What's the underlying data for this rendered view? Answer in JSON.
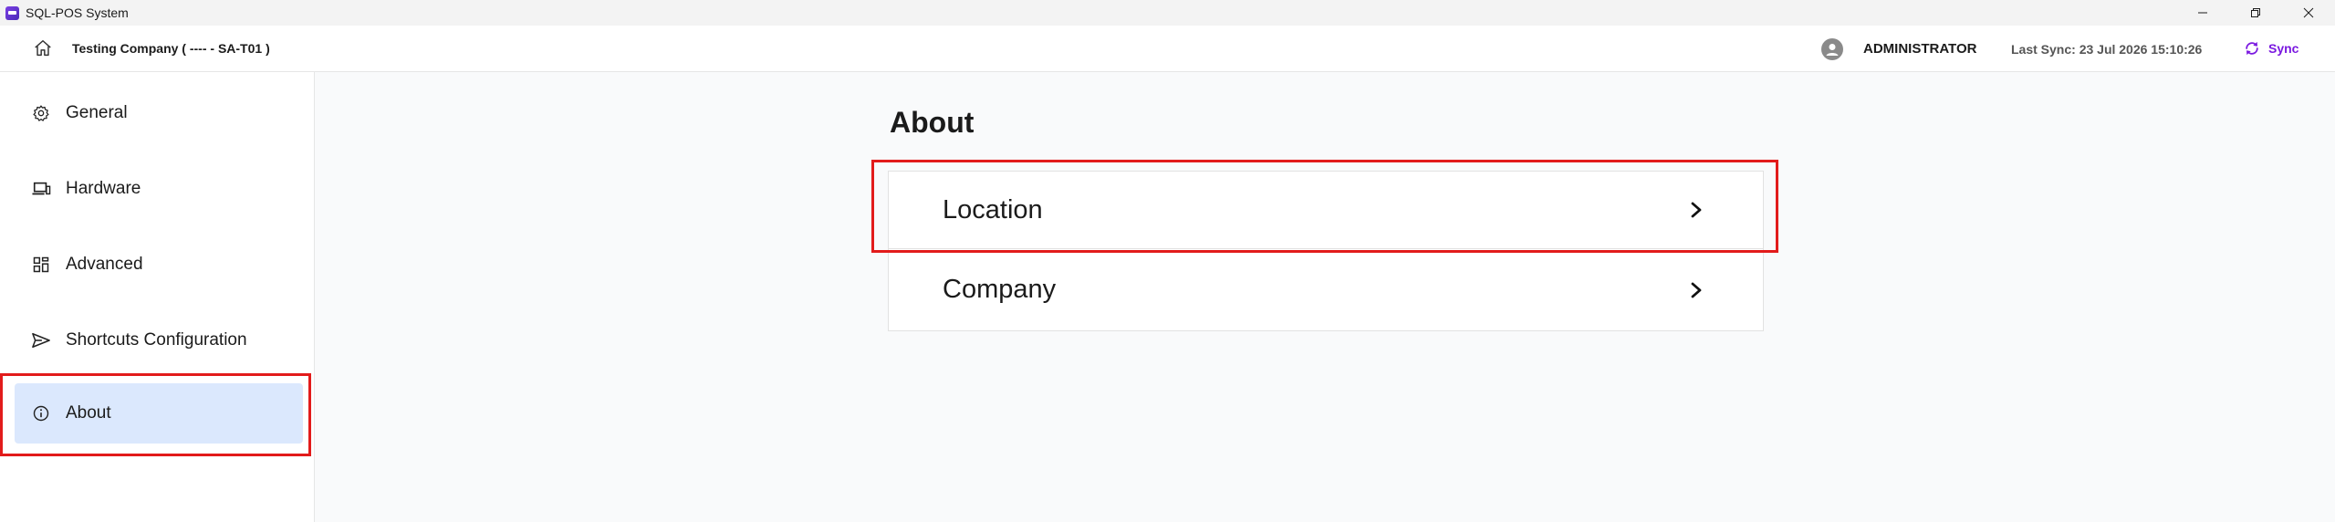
{
  "window": {
    "title": "SQL-POS System",
    "controls": [
      "minimize-icon",
      "restore-icon",
      "close-icon"
    ]
  },
  "header": {
    "company": "Testing Company ( ---- - SA-T01 )",
    "user": "ADMINISTRATOR",
    "last_sync": "Last Sync: 23 Jul 2026 15:10:26",
    "sync_label": "Sync"
  },
  "sidebar": {
    "items": [
      {
        "label": "General",
        "icon": "gear-icon"
      },
      {
        "label": "Hardware",
        "icon": "laptop-icon"
      },
      {
        "label": "Advanced",
        "icon": "grid-icon"
      },
      {
        "label": "Shortcuts Configuration",
        "icon": "send-icon"
      },
      {
        "label": "About",
        "icon": "info-icon",
        "active": true
      }
    ]
  },
  "main": {
    "title": "About",
    "items": [
      {
        "label": "Location"
      },
      {
        "label": "Company"
      }
    ]
  },
  "colors": {
    "accent": "#7a18e0",
    "active_bg": "#dbe8fd",
    "highlight": "#e21b1b"
  }
}
